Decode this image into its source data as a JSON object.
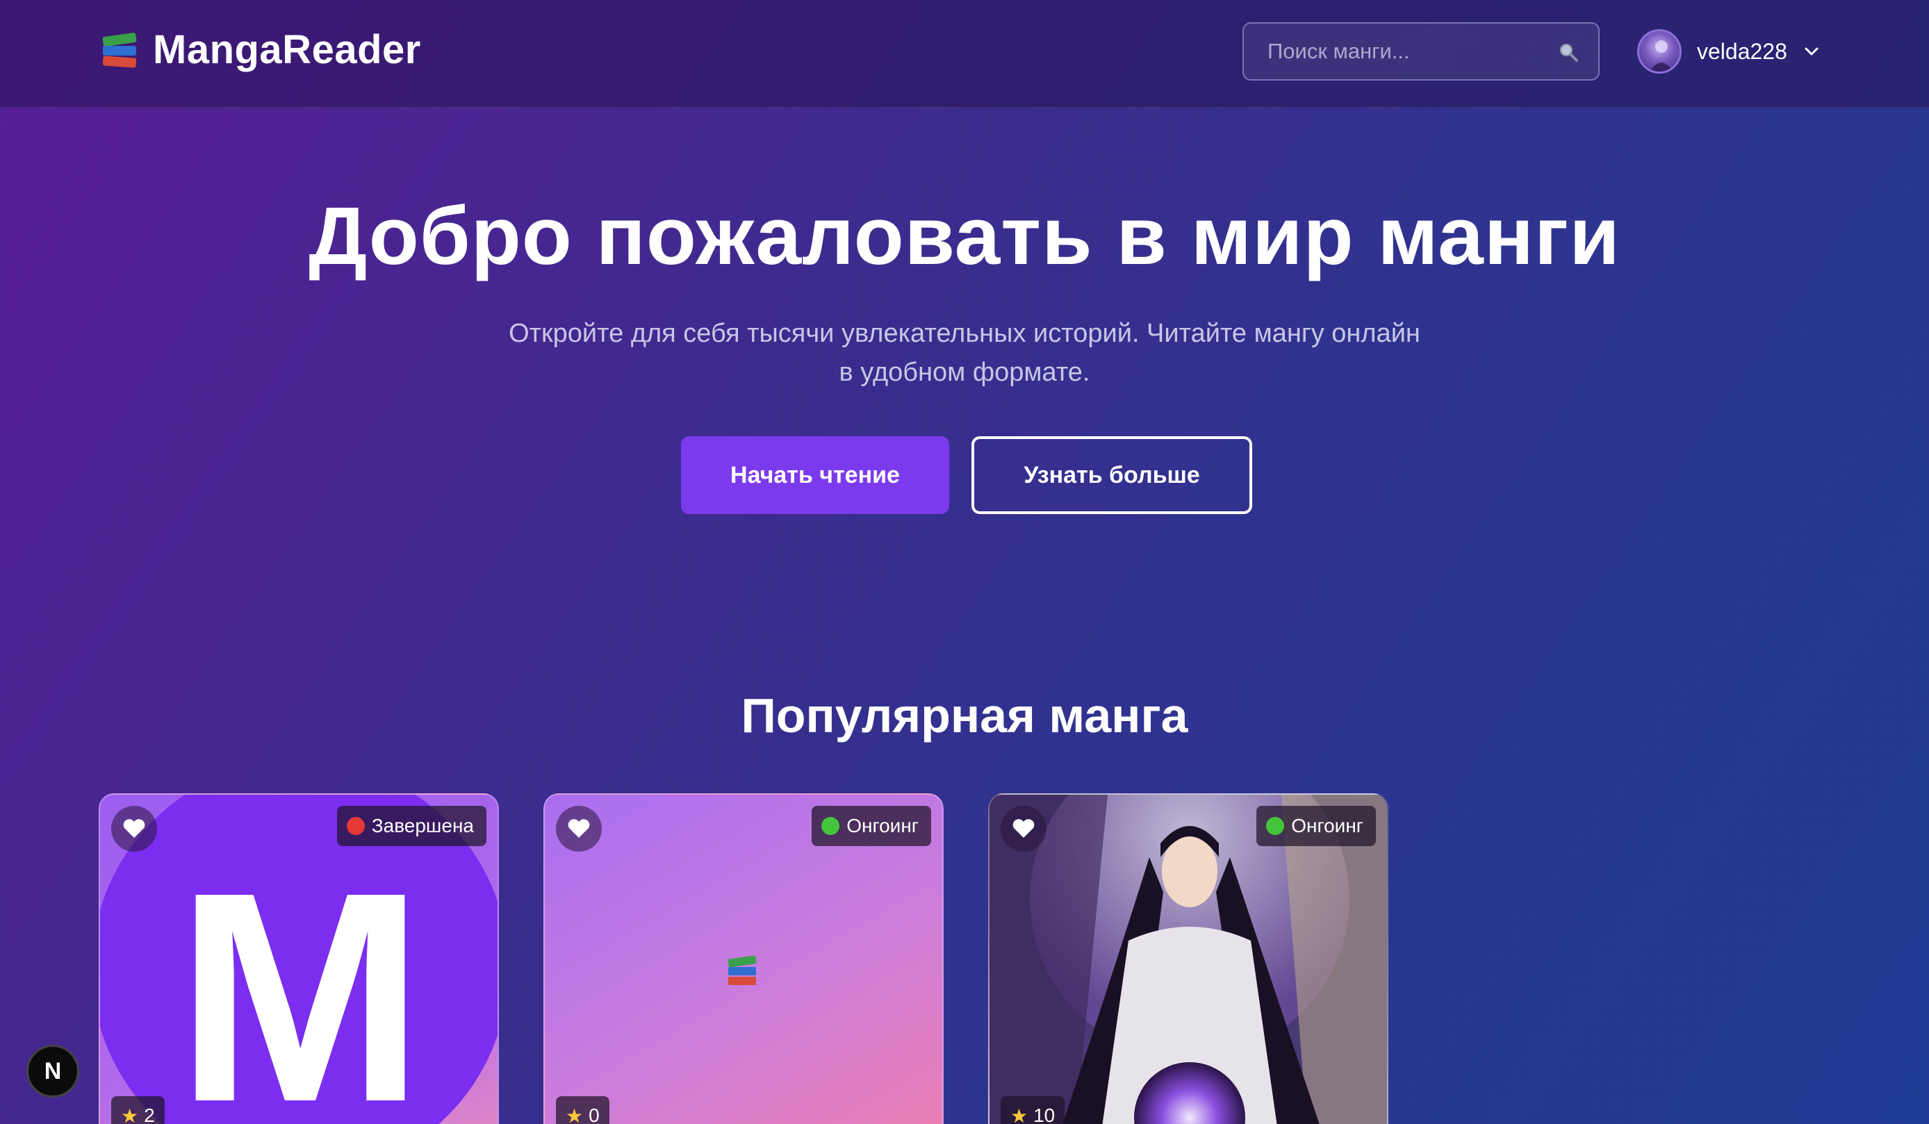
{
  "header": {
    "logo_text": "MangaReader",
    "search_placeholder": "Поиск манги...",
    "username": "velda228"
  },
  "hero": {
    "title": "Добро пожаловать в мир манги",
    "subtitle": "Откройте для себя тысячи увлекательных историй. Читайте мангу онлайн в удобном формате.",
    "primary_button": "Начать чтение",
    "secondary_button": "Узнать больше"
  },
  "popular": {
    "title": "Популярная манга",
    "cards": [
      {
        "status": "Завершена",
        "status_color": "#e53935",
        "rating": "2",
        "cover": "letter-M"
      },
      {
        "status": "Онгоинг",
        "status_color": "#43c43a",
        "rating": "0",
        "cover": "books-emoji"
      },
      {
        "status": "Онгоинг",
        "status_color": "#43c43a",
        "rating": "10",
        "cover": "artwork"
      }
    ]
  },
  "dev_indicator": {
    "label": "N"
  },
  "colors": {
    "accent": "#7c3aed"
  }
}
